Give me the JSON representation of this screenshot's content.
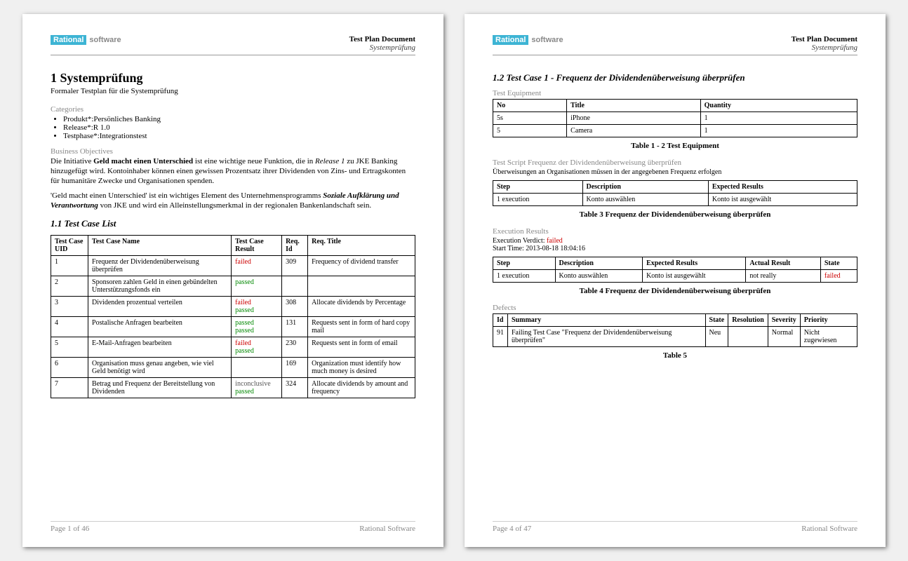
{
  "header": {
    "logo_rational": "Rational",
    "logo_software": "software",
    "doc_title": "Test Plan Document",
    "doc_sub": "Systemprüfung"
  },
  "page1": {
    "h1": "1   Systemprüfung",
    "subtitle": "Formaler Testplan für die Systemprüfung",
    "categories_label": "Categories",
    "categories": [
      "Produkt*:Persönliches Banking",
      "Release*:R 1.0",
      "Testphase*:Integrationstest"
    ],
    "biz_label": "Business Objectives",
    "biz_p1a": "Die Initiative ",
    "biz_p1b": "Geld macht einen Unterschied",
    "biz_p1c": " ist eine wichtige neue Funktion, die in ",
    "biz_p1d": "Release 1",
    "biz_p1e": " zu JKE Banking hinzugefügt wird. Kontoinhaber können einen gewissen Prozentsatz ihrer Dividenden von Zins- und Ertragskonten für humanitäre Zwecke und Organisationen spenden.",
    "biz_p2a": "'Geld macht einen Unterschied' ist ein wichtiges Element des Unternehmensprogramms ",
    "biz_p2b": "Soziale Aufklärung und Verantwortung",
    "biz_p2c": " von JKE und wird ein Alleinstellungsmerkmal in der regionalen Bankenlandschaft sein.",
    "tcl_heading": "1.1  Test Case List",
    "tcl_cols": [
      "Test Case UID",
      "Test Case Name",
      "Test Case Result",
      "Req. Id",
      "Req. Title"
    ],
    "tcl_rows": [
      {
        "uid": "1",
        "name": "Frequenz der Dividendenüberweisung überprüfen",
        "results": [
          {
            "t": "failed",
            "c": "failed"
          }
        ],
        "req": "309",
        "title": "Frequency of dividend transfer"
      },
      {
        "uid": "2",
        "name": "Sponsoren zahlen Geld in einen gebündelten Unterstützungsfonds ein",
        "results": [
          {
            "t": "passed",
            "c": "passed"
          }
        ],
        "req": "",
        "title": ""
      },
      {
        "uid": "3",
        "name": "Dividenden prozentual verteilen",
        "results": [
          {
            "t": "failed",
            "c": "failed"
          },
          {
            "t": "passed",
            "c": "passed"
          }
        ],
        "req": "308",
        "title": "Allocate dividends by Percentage"
      },
      {
        "uid": "4",
        "name": "Postalische Anfragen bearbeiten",
        "results": [
          {
            "t": "passed",
            "c": "passed"
          },
          {
            "t": "passed",
            "c": "passed"
          }
        ],
        "req": "131",
        "title": "Requests sent in form of hard copy mail"
      },
      {
        "uid": "5",
        "name": "E-Mail-Anfragen bearbeiten",
        "results": [
          {
            "t": "failed",
            "c": "failed"
          },
          {
            "t": "passed",
            "c": "passed"
          }
        ],
        "req": "230",
        "title": "Requests sent in form of email"
      },
      {
        "uid": "6",
        "name": "Organisation muss genau angeben, wie viel Geld benötigt wird",
        "results": [],
        "req": "169",
        "title": "Organization must identify how much money is desired"
      },
      {
        "uid": "7",
        "name": "Betrag und Frequenz der Bereitstellung von Dividenden",
        "results": [
          {
            "t": "inconclusive",
            "c": "inconclusive"
          },
          {
            "t": "passed",
            "c": "passed"
          }
        ],
        "req": "324",
        "title": "Allocate dividends by amount and frequency"
      }
    ],
    "footer_left": "Page 1 of  46",
    "footer_right": "Rational Software"
  },
  "page2": {
    "h2": "1.2  Test Case 1 - Frequenz der Dividendenüberweisung überprüfen",
    "equip_label": "Test Equipment",
    "equip_cols": [
      "No",
      "Title",
      "Quantity"
    ],
    "equip_rows": [
      {
        "no": "5s",
        "title": "iPhone",
        "qty": "1"
      },
      {
        "no": "5",
        "title": "Camera",
        "qty": "1"
      }
    ],
    "equip_caption": "Table 1 - 2 Test Equipment",
    "script_label": "Test Script Frequenz der Dividendenüberweisung überprüfen",
    "script_desc": "Überweisungen an Organisationen müssen in der angegebenen Frequenz erfolgen",
    "script_cols": [
      "Step",
      "Description",
      "Expected Results"
    ],
    "script_rows": [
      {
        "step": "1 execution",
        "desc": "Konto auswählen",
        "exp": "Konto ist ausgewählt"
      }
    ],
    "script_caption": "Table 3 Frequenz der Dividendenüberweisung überprüfen",
    "exec_label": "Execution Results",
    "exec_verdict_label": "Execution Verdict: ",
    "exec_verdict": "failed",
    "exec_start": "Start Time: 2013-08-18 18:04:16",
    "exec_cols": [
      "Step",
      "Description",
      "Expected Results",
      "Actual Result",
      "State"
    ],
    "exec_rows": [
      {
        "step": "1 execution",
        "desc": "Konto auswählen",
        "exp": "Konto ist ausgewählt",
        "act": "not really",
        "state": "failed"
      }
    ],
    "exec_caption": "Table 4 Frequenz der Dividendenüberweisung überprüfen",
    "defects_label": "Defects",
    "defects_cols": [
      "Id",
      "Summary",
      "State",
      "Resolution",
      "Severity",
      "Priority"
    ],
    "defects_rows": [
      {
        "id": "91",
        "summary": "Failing Test Case \"Frequenz der Dividendenüberweisung überprüfen\"",
        "state": "Neu",
        "res": "",
        "sev": "Normal",
        "pri": "Nicht zugewiesen"
      }
    ],
    "defects_caption": "Table 5",
    "footer_left": "Page 4 of  47",
    "footer_right": "Rational Software"
  }
}
